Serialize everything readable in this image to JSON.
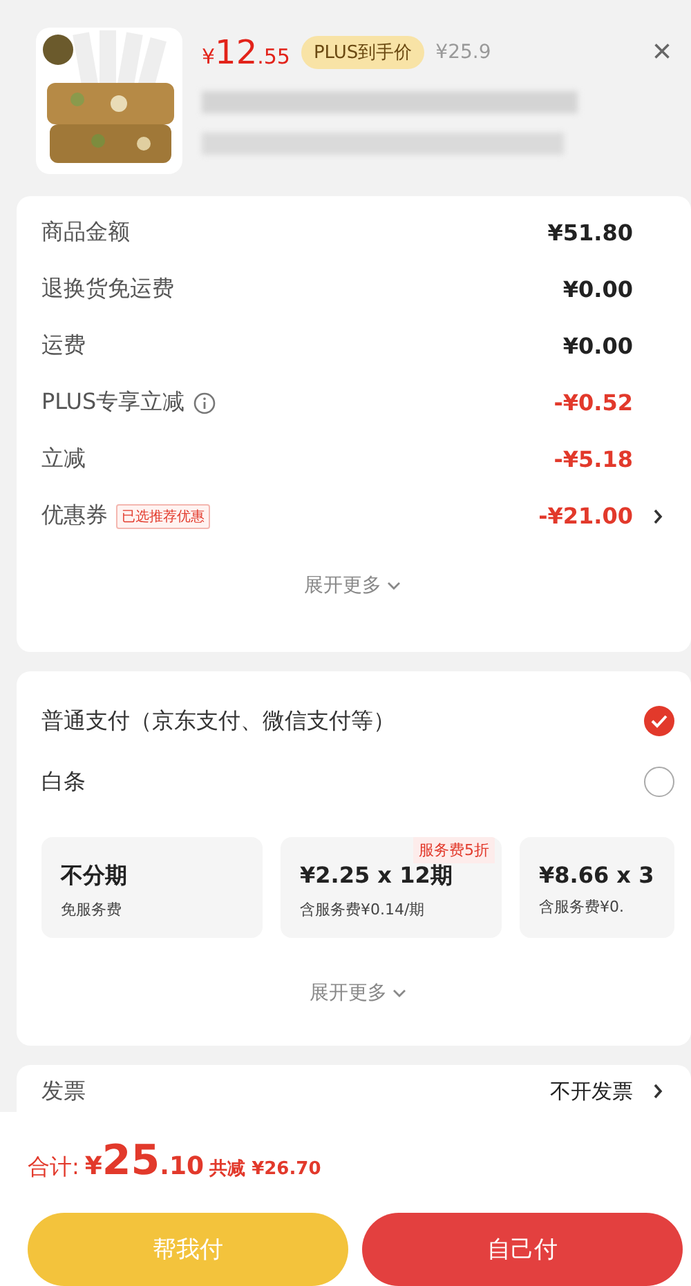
{
  "product": {
    "price_symbol": "¥",
    "price_int": "12",
    "price_dec": ".55",
    "plus_tag": "PLUS到手价",
    "original_price": "¥25.9",
    "close": "×"
  },
  "amounts": [
    {
      "label": "商品金额",
      "value": "¥51.80",
      "kind": "plain"
    },
    {
      "label": "退换货免运费",
      "value": "¥0.00",
      "kind": "plain"
    },
    {
      "label": "运费",
      "value": "¥0.00",
      "kind": "plain"
    },
    {
      "label": "PLUS专享立减",
      "value": "-¥0.52",
      "kind": "info"
    },
    {
      "label": "立减",
      "value": "-¥5.18",
      "kind": "discount"
    },
    {
      "label": "优惠券",
      "value": "-¥21.00",
      "kind": "coupon",
      "tag": "已选推荐优惠"
    }
  ],
  "amounts_more": "展开更多",
  "payment_methods": [
    {
      "label": "普通支付（京东支付、微信支付等）",
      "selected": true
    },
    {
      "label": "白条",
      "selected": false
    }
  ],
  "installments": [
    {
      "title": "不分期",
      "sub": "免服务费"
    },
    {
      "title": "¥2.25 x 12期",
      "sub": "含服务费¥0.14/期",
      "badge": "服务费5折"
    },
    {
      "title": "¥8.66 x 3",
      "sub": "含服务费¥0."
    }
  ],
  "payment_more": "展开更多",
  "invoice": {
    "label": "发票",
    "value": "不开发票"
  },
  "footer": {
    "total_label": "合计:",
    "total_symbol": "¥",
    "total_int": "25",
    "total_dec": ".10",
    "saved": "共减 ¥26.70",
    "buttons": [
      {
        "label": "帮我付",
        "kind": "secondary"
      },
      {
        "label": "自己付",
        "kind": "primary"
      }
    ]
  }
}
